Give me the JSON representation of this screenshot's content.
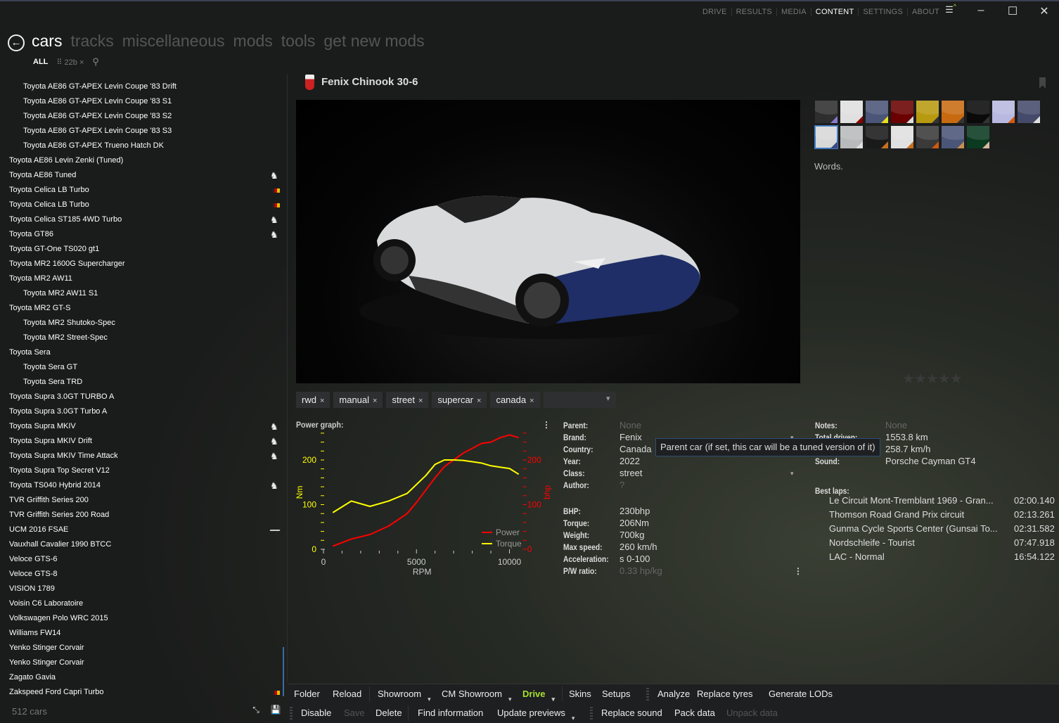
{
  "topnav": {
    "items": [
      "DRIVE",
      "RESULTS",
      "MEDIA",
      "CONTENT",
      "SETTINGS",
      "ABOUT"
    ],
    "active": "CONTENT"
  },
  "mainnav": {
    "items": [
      "cars",
      "tracks",
      "miscellaneous",
      "mods",
      "tools",
      "get new mods"
    ],
    "active": "cars"
  },
  "filters": {
    "all": "ALL",
    "tag": "22b",
    "tag_close": "×"
  },
  "car_list": [
    {
      "label": "Toyota AE86 GT-APEX Levin Coupe '83 Drift",
      "child": true
    },
    {
      "label": "Toyota AE86 GT-APEX Levin Coupe '83 S1",
      "child": true
    },
    {
      "label": "Toyota AE86 GT-APEX Levin Coupe '83 S2",
      "child": true
    },
    {
      "label": "Toyota AE86 GT-APEX Levin Coupe '83 S3",
      "child": true
    },
    {
      "label": "Toyota AE86 GT-APEX Trueno Hatch DK",
      "child": true
    },
    {
      "label": "Toyota AE86 Levin Zenki (Tuned)"
    },
    {
      "label": "Toyota AE86 Tuned",
      "badge": "horse"
    },
    {
      "label": "Toyota Celica LB Turbo",
      "badge": "drm"
    },
    {
      "label": "Toyota Celica LB Turbo",
      "badge": "drm"
    },
    {
      "label": "Toyota Celica ST185 4WD Turbo",
      "badge": "horse"
    },
    {
      "label": "Toyota GT86",
      "badge": "horse"
    },
    {
      "label": "Toyota GT-One TS020 gt1"
    },
    {
      "label": "Toyota MR2 1600G Supercharger"
    },
    {
      "label": "Toyota MR2 AW11"
    },
    {
      "label": "Toyota MR2 AW11 S1",
      "child": true
    },
    {
      "label": "Toyota MR2 GT-S"
    },
    {
      "label": "Toyota MR2 Shutoko-Spec",
      "child": true
    },
    {
      "label": "Toyota MR2 Street-Spec",
      "child": true
    },
    {
      "label": "Toyota Sera"
    },
    {
      "label": "Toyota Sera GT",
      "child": true
    },
    {
      "label": "Toyota Sera TRD",
      "child": true
    },
    {
      "label": "Toyota Supra 3.0GT TURBO A"
    },
    {
      "label": "Toyota Supra 3.0GT Turbo A"
    },
    {
      "label": "Toyota Supra MKIV",
      "badge": "horse"
    },
    {
      "label": "Toyota Supra MKIV Drift",
      "badge": "horse"
    },
    {
      "label": "Toyota Supra MKIV Time Attack",
      "badge": "horse"
    },
    {
      "label": "Toyota Supra Top Secret V12"
    },
    {
      "label": "Toyota TS040 Hybrid 2014",
      "badge": "horse"
    },
    {
      "label": "TVR Griffith Series 200"
    },
    {
      "label": "TVR Griffith Series 200 Road"
    },
    {
      "label": "UCM 2016 FSAE",
      "badge": "ucm"
    },
    {
      "label": "Vauxhall Cavalier 1990 BTCC"
    },
    {
      "label": "Veloce GTS-6"
    },
    {
      "label": "Veloce GTS-8"
    },
    {
      "label": "VISION 1789"
    },
    {
      "label": "Voisin C6 Laboratoire"
    },
    {
      "label": "Volkswagen Polo WRC 2015"
    },
    {
      "label": "Williams FW14"
    },
    {
      "label": "Yenko Stinger Corvair"
    },
    {
      "label": "Yenko Stinger Corvair"
    },
    {
      "label": "Zagato Gavia"
    },
    {
      "label": "Zakspeed Ford Capri Turbo",
      "badge": "drm"
    }
  ],
  "car_count": "512 cars",
  "car": {
    "title": "Fenix Chinook 30-6",
    "description": "Words.",
    "rating_stars": "★★★★★",
    "rating": 0
  },
  "skins": [
    [
      "#2e2e2e",
      "#8a7ad0"
    ],
    [
      "#e0e0e0",
      "#8a0000"
    ],
    [
      "#4a5578",
      "#e8e020"
    ],
    [
      "#6a0000",
      "#e0e0e0"
    ],
    [
      "#b89a10",
      "#333"
    ],
    [
      "#c86a10",
      "#333"
    ],
    [
      "#0a0a0a",
      "#333"
    ],
    [
      "#b8b8e0",
      "#d05a10"
    ],
    [
      "#454a6a",
      "#e0e0e0"
    ],
    [
      "#d8d8d8",
      "#3a4a80"
    ],
    [
      "#b8babc",
      "#e0e0e0"
    ],
    [
      "#1a1a1a",
      "#c87020"
    ],
    [
      "#e0e0e0",
      "#c87020"
    ],
    [
      "#3a3a3a",
      "#d05a10"
    ],
    [
      "#4a5578",
      "#c89050"
    ],
    [
      "#0a3a20",
      "#d8b8a0"
    ]
  ],
  "tags": [
    "rwd",
    "manual",
    "street",
    "supercar",
    "canada"
  ],
  "tag_close": "×",
  "power_graph": {
    "label": "Power graph:"
  },
  "chart_data": {
    "type": "line",
    "xlabel": "RPM",
    "ylabel_left": "Nm",
    "ylabel_right": "bhp",
    "xlim": [
      0,
      10500
    ],
    "ylim_left": [
      0,
      260
    ],
    "ylim_right": [
      0,
      260
    ],
    "x_ticks": [
      "0",
      "5000",
      "10000"
    ],
    "y_ticks_left": [
      "0",
      "100",
      "200"
    ],
    "y_ticks_right": [
      "0",
      "100",
      "200"
    ],
    "legend_placement": "bottom-right",
    "series": [
      {
        "name": "Power",
        "axis": "right",
        "color": "#ff0000",
        "x": [
          500,
          1500,
          2500,
          3500,
          4500,
          5000,
          6000,
          6500,
          7500,
          8500,
          9000,
          9500,
          10000,
          10500
        ],
        "y": [
          7,
          23,
          33,
          52,
          80,
          105,
          160,
          185,
          215,
          237,
          240,
          250,
          256,
          250
        ]
      },
      {
        "name": "Torque",
        "axis": "left",
        "color": "#ffff00",
        "x": [
          500,
          1500,
          2500,
          3500,
          4500,
          5500,
          6000,
          6500,
          7000,
          7500,
          8500,
          9000,
          9500,
          10000,
          10500
        ],
        "y": [
          82,
          108,
          96,
          108,
          125,
          165,
          190,
          200,
          200,
          199,
          193,
          187,
          184,
          181,
          168
        ]
      }
    ]
  },
  "props": [
    {
      "k": "Parent:",
      "v": "None",
      "dim": true
    },
    {
      "k": "Brand:",
      "v": "Fenix"
    },
    {
      "k": "Country:",
      "v": "Canada"
    },
    {
      "k": "Year:",
      "v": "2022"
    },
    {
      "k": "Class:",
      "v": "street"
    },
    {
      "k": "Author:",
      "v": "?",
      "dim": true
    }
  ],
  "specs": [
    {
      "k": "BHP:",
      "v": "230bhp"
    },
    {
      "k": "Torque:",
      "v": "206Nm"
    },
    {
      "k": "Weight:",
      "v": "700kg"
    },
    {
      "k": "Max speed:",
      "v": "260 km/h"
    },
    {
      "k": "Acceleration:",
      "v": "s 0-100"
    },
    {
      "k": "P/W ratio:",
      "v": "0.33 hp/kg",
      "dim": true
    }
  ],
  "right_props": [
    {
      "k": "Notes:",
      "v": "None",
      "dim": true
    },
    {
      "k": "Total driven:",
      "v": "1553.8 km"
    },
    {
      "k": "",
      "v": "258.7 km/h"
    },
    {
      "k": "Sound:",
      "v": "Porsche Cayman GT4"
    }
  ],
  "tooltip": "Parent car (if set, this car will be a tuned version of it)",
  "best_laps_label": "Best laps:",
  "best_laps": [
    {
      "track": "Le Circuit Mont-Tremblant 1969 - Gran...",
      "time": "02:00.140"
    },
    {
      "track": "Thomson Road Grand Prix circuit",
      "time": "02:13.261"
    },
    {
      "track": "Gunma Cycle Sports Center (Gunsai To...",
      "time": "02:31.582"
    },
    {
      "track": "Nordschleife - Tourist",
      "time": "07:47.918"
    },
    {
      "track": "LAC - Normal",
      "time": "16:54.122"
    }
  ],
  "toolbar": {
    "row1": [
      "Folder",
      "Reload",
      "Showroom",
      "CM Showroom",
      "Drive",
      "Skins",
      "Setups",
      "Analyze",
      "Replace tyres",
      "Generate LODs"
    ],
    "row2": [
      "Disable",
      "Save",
      "Delete",
      "Find information",
      "Update previews",
      "Replace sound",
      "Pack data",
      "Unpack data"
    ]
  },
  "colors": {
    "accent": "#3c78c0",
    "drive": "#a6e22e",
    "power": "#ff0000",
    "torque": "#ffff00"
  }
}
